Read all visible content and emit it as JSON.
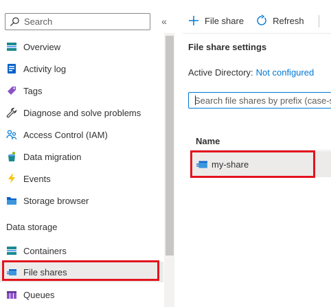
{
  "sidebar": {
    "search_placeholder": "Search",
    "collapse_glyph": "«",
    "items": [
      {
        "label": "Overview",
        "icon": "overview-icon"
      },
      {
        "label": "Activity log",
        "icon": "activity-log-icon"
      },
      {
        "label": "Tags",
        "icon": "tag-icon"
      },
      {
        "label": "Diagnose and solve problems",
        "icon": "wrench-icon"
      },
      {
        "label": "Access Control (IAM)",
        "icon": "people-icon"
      },
      {
        "label": "Data migration",
        "icon": "data-migration-icon"
      },
      {
        "label": "Events",
        "icon": "lightning-icon"
      },
      {
        "label": "Storage browser",
        "icon": "folder-icon"
      }
    ],
    "section_label": "Data storage",
    "section_items": [
      {
        "label": "Containers",
        "icon": "containers-icon"
      },
      {
        "label": "File shares",
        "icon": "file-share-icon",
        "selected": true
      },
      {
        "label": "Queues",
        "icon": "queues-icon"
      }
    ]
  },
  "toolbar": {
    "add_label": "File share",
    "refresh_label": "Refresh"
  },
  "main": {
    "settings_title": "File share settings",
    "ad_label": "Active Directory:",
    "ad_value": "Not configured",
    "search_placeholder": "Search file shares by prefix (case-sensitive)",
    "table": {
      "columns": [
        "Name"
      ],
      "rows": [
        {
          "name": "my-share"
        }
      ]
    }
  },
  "colors": {
    "accent": "#0078d4",
    "highlight": "#e3141e",
    "selected_bg": "#edebe9"
  }
}
